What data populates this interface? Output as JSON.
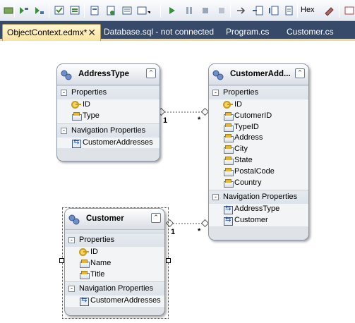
{
  "toolbar": {
    "hex_label": "Hex",
    "buttons": [
      "toggle-icon",
      "run-icon",
      "stack-icon",
      "window-icon",
      "window2-icon",
      "doc-icon",
      "doc2-icon",
      "list-icon",
      "dropdown-icon",
      "play-icon",
      "pause-icon",
      "stop-icon",
      "restart-icon",
      "step-icon",
      "step-over-icon",
      "step-out-icon",
      "watch-icon",
      "hex-icon",
      "settings-icon"
    ]
  },
  "tabs": [
    {
      "label": "ObjectContext.edmx*",
      "active": true
    },
    {
      "label": "Database.sql - not connected",
      "active": false
    },
    {
      "label": "Program.cs",
      "active": false
    },
    {
      "label": "Customer.cs",
      "active": false
    }
  ],
  "tab_close": "✕",
  "entities": {
    "addresstype": {
      "title": "AddressType",
      "properties_header": "Properties",
      "properties": [
        "ID",
        "Type"
      ],
      "nav_header": "Navigation Properties",
      "nav_properties": [
        "CustomerAddresses"
      ]
    },
    "customeraddress": {
      "title": "CustomerAdd...",
      "properties_header": "Properties",
      "properties": [
        "ID",
        "CutomerID",
        "TypeID",
        "Address",
        "City",
        "State",
        "PostalCode",
        "Country"
      ],
      "nav_header": "Navigation Properties",
      "nav_properties": [
        "AddressType",
        "Customer"
      ]
    },
    "customer": {
      "title": "Customer",
      "properties_header": "Properties",
      "properties": [
        "ID",
        "Name",
        "Title"
      ],
      "nav_header": "Navigation Properties",
      "nav_properties": [
        "CustomerAddresses"
      ]
    }
  },
  "associations": [
    {
      "from": "AddressType",
      "to": "CustomerAddress",
      "from_mult": "1",
      "to_mult": "*"
    },
    {
      "from": "Customer",
      "to": "CustomerAddress",
      "from_mult": "1",
      "to_mult": "*"
    }
  ],
  "collapse_glyph": "⌃"
}
